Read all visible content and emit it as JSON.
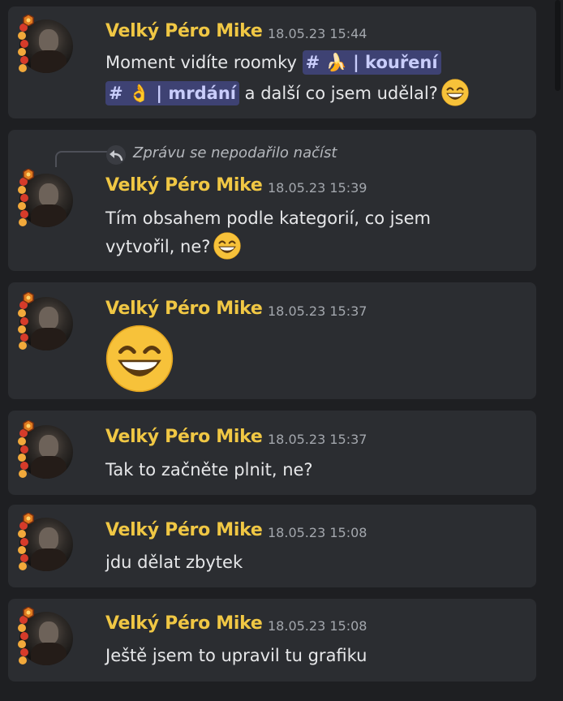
{
  "colors": {
    "background": "#1e1f22",
    "message_background": "#2b2d31",
    "author": "#f0c744",
    "timestamp": "#a3a7ad",
    "text": "#e6e7e9",
    "mention_background": "#3e4273",
    "mention_text": "#c9cdfb"
  },
  "messages": [
    {
      "author": "Velký Péro Mike",
      "time": "18.05.23 15:44",
      "line1_text": "Moment vidíte roomky",
      "mention1": {
        "hash": "#",
        "emoji": "🍌",
        "sep": "|",
        "name": "kouření"
      },
      "mention2": {
        "hash": "#",
        "emoji": "👌",
        "sep": "|",
        "name": "mrdání"
      },
      "line2_text": "a další co jsem udělal?",
      "emoji": "grinning-face-icon"
    },
    {
      "reply_text": "Zprávu se nepodařilo načíst",
      "author": "Velký Péro Mike",
      "time": "18.05.23 15:39",
      "line1": "Tím obsahem podle kategorií, co jsem",
      "line2": "vytvořil, ne?",
      "emoji": "grinning-face-icon"
    },
    {
      "author": "Velký Péro Mike",
      "time": "18.05.23 15:37",
      "emoji": "grinning-face-icon"
    },
    {
      "author": "Velký Péro Mike",
      "time": "18.05.23 15:37",
      "text": "Tak to začněte plnit, ne?"
    },
    {
      "author": "Velký Péro Mike",
      "time": "18.05.23 15:08",
      "text": "jdu dělat zbytek"
    },
    {
      "author": "Velký Péro Mike",
      "time": "18.05.23 15:08",
      "text": "Ještě jsem to upravil tu grafiku"
    }
  ]
}
